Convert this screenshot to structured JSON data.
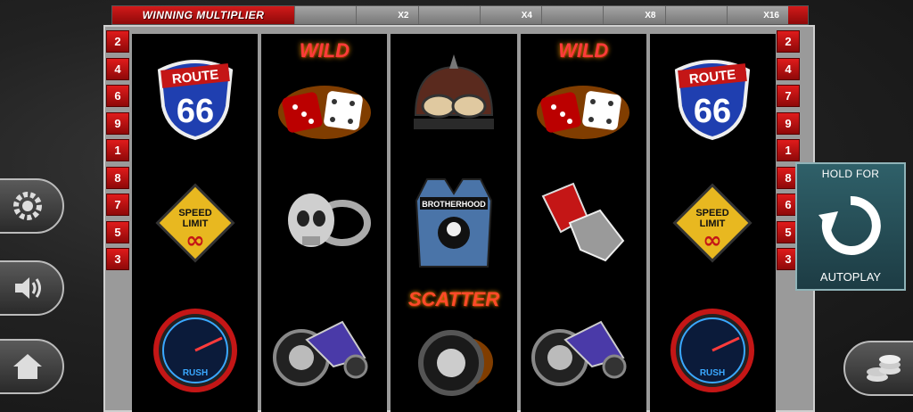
{
  "multiplier": {
    "title": "WINNING MULTIPLIER",
    "steps": [
      "",
      "X2",
      "",
      "X4",
      "",
      "X8",
      "",
      "X16"
    ]
  },
  "paylines": {
    "left": [
      "2",
      "4",
      "6",
      "9",
      "1",
      "8",
      "7",
      "5",
      "3"
    ],
    "right": [
      "2",
      "4",
      "7",
      "9",
      "1",
      "8",
      "6",
      "5",
      "3"
    ]
  },
  "reels": [
    [
      {
        "symbol": "route66",
        "text": "ROUTE 66"
      },
      {
        "symbol": "speed-limit",
        "text": "SPEED LIMIT"
      },
      {
        "symbol": "speedometer",
        "text": "RUSH"
      }
    ],
    [
      {
        "symbol": "wild",
        "text": "WILD"
      },
      {
        "symbol": "skull-ring",
        "text": ""
      },
      {
        "symbol": "motorcycle",
        "text": ""
      }
    ],
    [
      {
        "symbol": "helmet",
        "text": ""
      },
      {
        "symbol": "vest",
        "text": "BROTHERHOOD"
      },
      {
        "symbol": "scatter",
        "text": "SCATTER"
      }
    ],
    [
      {
        "symbol": "wild",
        "text": "WILD"
      },
      {
        "symbol": "gloves",
        "text": ""
      },
      {
        "symbol": "motorcycle",
        "text": ""
      }
    ],
    [
      {
        "symbol": "route66",
        "text": "ROUTE 66"
      },
      {
        "symbol": "speed-limit",
        "text": "SPEED LIMIT"
      },
      {
        "symbol": "speedometer",
        "text": "RUSH"
      }
    ]
  ],
  "autoplay": {
    "top": "HOLD FOR",
    "bottom": "AUTOPLAY"
  },
  "buttons": {
    "settings": "gear-icon",
    "sound": "speaker-icon",
    "home": "home-icon",
    "coins": "coins-icon"
  },
  "colors": {
    "accent_red": "#d21a1a",
    "autoplay_bg": "#2f6069"
  }
}
